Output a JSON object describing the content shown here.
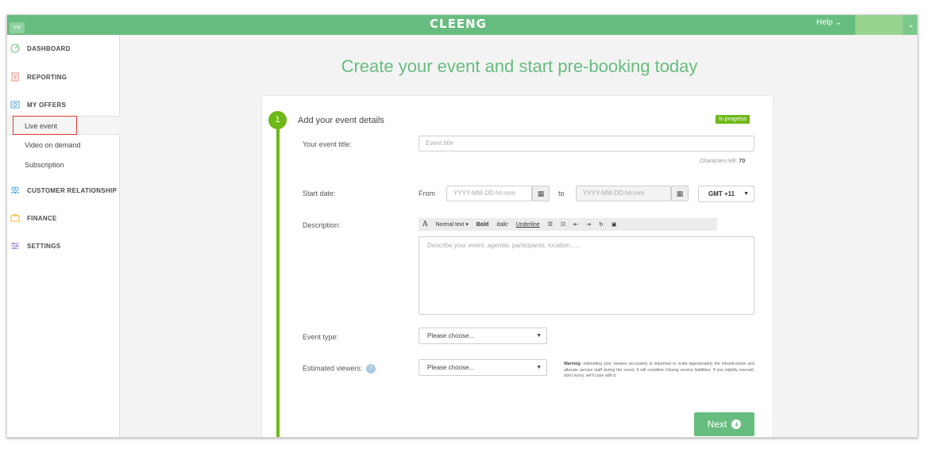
{
  "topbar": {
    "collapse_label": "<≡",
    "logo": "CLEENG",
    "help": "Help ⌄",
    "user_chevron": "⌄"
  },
  "sidebar": {
    "dashboard": "DASHBOARD",
    "reporting": "REPORTING",
    "my_offers": "MY OFFERS",
    "live_event": "Live event",
    "video_on_demand": "Video on demand",
    "subscription": "Subscription",
    "customer_relationship": "CUSTOMER RELATIONSHIP",
    "finance": "FINANCE",
    "settings": "SETTINGS"
  },
  "main": {
    "headline": "Create your event and start pre-booking today",
    "step_number": "1",
    "step_title": "Add your event details",
    "status_badge": "In progress",
    "event_title_label": "Your event title:",
    "event_title_placeholder": "Event title",
    "chars_left_label": "Characters left:",
    "chars_left_value": "70",
    "start_date_label": "Start date:",
    "from_label": "From",
    "from_placeholder": "YYYY-MM-DD hh:mm",
    "to_label": "to",
    "to_placeholder": "YYYY-MM-DD hh:mm",
    "timezone": "GMT +11",
    "description_label": "Description:",
    "toolbar": {
      "font": "A",
      "normal_text": "Normal text ▾",
      "bold": "Bold",
      "italic": "Italic",
      "underline": "Underline",
      "unordered_list": "☰",
      "ordered_list": "☷",
      "outdent": "⇤",
      "indent": "⇥",
      "link": "↻",
      "image": "▣"
    },
    "description_placeholder": "Describe your event: agenda, participants, location......",
    "event_type_label": "Event type:",
    "event_type_value": "Please choose...",
    "estimated_viewers_label": "Estimated viewers:",
    "estimated_viewers_help": "?",
    "estimated_viewers_value": "Please choose...",
    "warning_title": "Warning:",
    "warning_text": " estimating your viewers accurately is important to scale appropriately the infrastructure and allocate service staff during the event. It will condition Cleeng service liabilities. If you slightly oversell, don't worry, we'll cope with it.",
    "next_label": "Next",
    "next_icon": "➜"
  },
  "colors": {
    "brand_green": "#67bd7f",
    "step_green": "#6eb817",
    "highlight_red": "#e53935"
  }
}
